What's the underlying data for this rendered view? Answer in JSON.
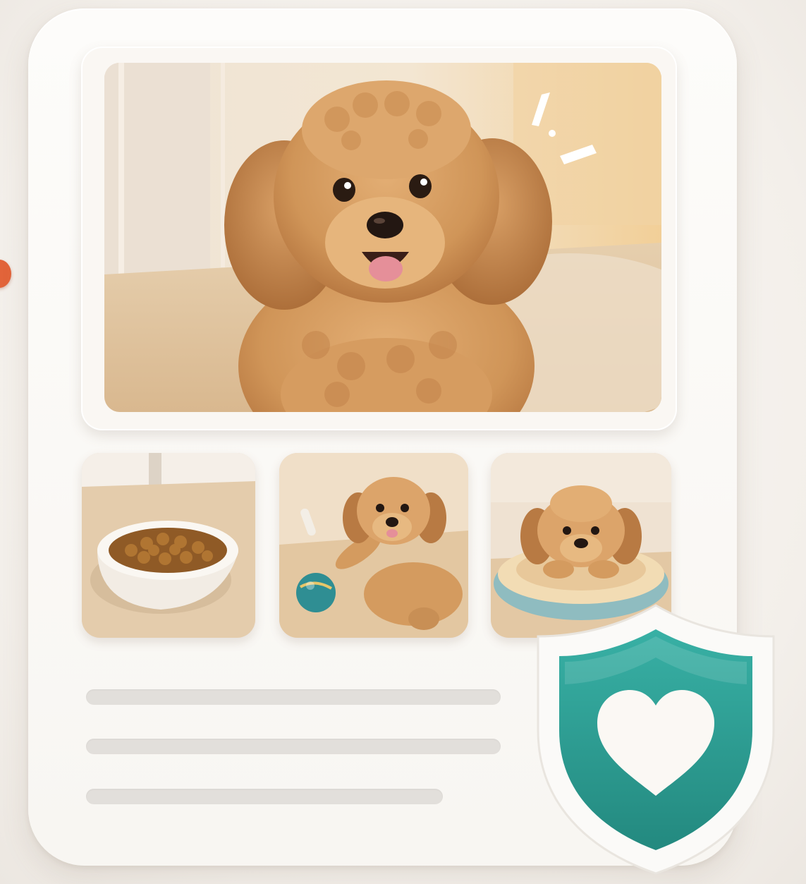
{
  "card": {
    "hero_image": "curly-apricot-puppy-photo",
    "thumbnails": [
      {
        "subject": "food-bowl-photo"
      },
      {
        "subject": "puppy-playing-with-ball-photo"
      },
      {
        "subject": "puppy-resting-on-bed-photo"
      }
    ],
    "placeholder_lines": 3
  },
  "badge": {
    "icon": "shield-heart-icon",
    "color": "#2fa39a"
  },
  "colors": {
    "accent": "#e2643a",
    "card": "#fbf9f6",
    "placeholder": "#e2dfdb",
    "fur": "#d39a62"
  }
}
